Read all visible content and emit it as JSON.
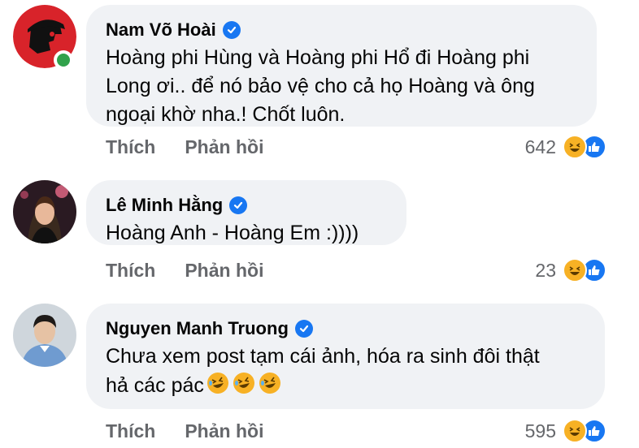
{
  "comments": [
    {
      "author": "Nam Võ Hoài",
      "text_lines": [
        "Hoàng phi Hùng và Hoàng phi Hổ đi Hoàng phi",
        "Long ơi.. để nó bảo vệ cho cả họ Hoàng và ông",
        "ngoại khờ nha.! Chốt luôn."
      ],
      "verified": true,
      "online": true,
      "like_label": "Thích",
      "reply_label": "Phản hồi",
      "reaction_count": "642",
      "reaction_icons": [
        "haha-icon",
        "like-icon"
      ]
    },
    {
      "author": "Lê Minh Hằng",
      "text_lines": [
        "Hoàng Anh - Hoàng Em :))))"
      ],
      "verified": true,
      "online": false,
      "like_label": "Thích",
      "reply_label": "Phản hồi",
      "reaction_count": "23",
      "reaction_icons": [
        "haha-icon",
        "like-icon"
      ]
    },
    {
      "author": "Nguyen Manh Truong",
      "text_lines": [
        "Chưa xem post tạm cái ảnh, hóa ra sinh đôi thật",
        "hả các pác"
      ],
      "trailing_emojis": [
        "rofl-icon",
        "rofl-icon",
        "rofl-icon"
      ],
      "verified": true,
      "online": false,
      "like_label": "Thích",
      "reply_label": "Phản hồi",
      "reaction_count": "595",
      "reaction_icons": [
        "haha-icon",
        "like-icon"
      ]
    }
  ],
  "colors": {
    "bubble_bg": "#f0f2f5",
    "verified_blue": "#1877f2",
    "action_gray": "#65676b",
    "online_green": "#31a24c",
    "haha_yellow": "#f7b125"
  }
}
